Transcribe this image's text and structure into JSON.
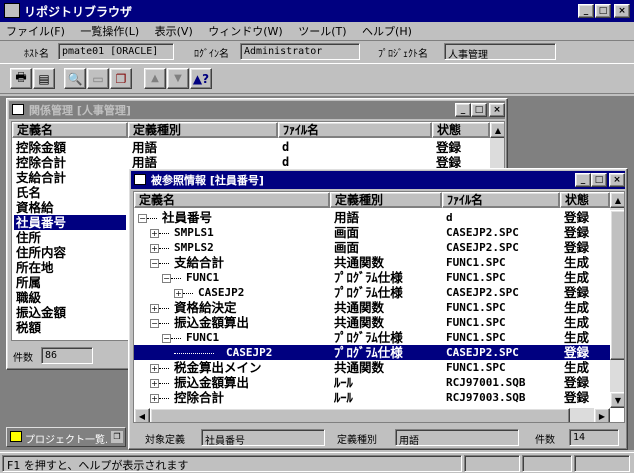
{
  "app": {
    "title": "リポジトリブラウザ"
  },
  "menu": [
    "ファイル(F)",
    "一覧操作(L)",
    "表示(V)",
    "ウィンドウ(W)",
    "ツール(T)",
    "ヘルプ(H)"
  ],
  "info": {
    "host_label": "ﾎｽﾄ名",
    "host_value": "pmate01 [ORACLE]",
    "login_label": "ﾛｸﾞｲﾝ名",
    "login_value": "Administrator",
    "project_label": "ﾌﾟﾛｼﾞｪｸﾄ名",
    "project_value": "人事管理"
  },
  "toolbar": {
    "icons": [
      "print-icon",
      "print-preview-icon",
      "search-icon",
      "copy-icon",
      "window-icon",
      "up-arrow-icon",
      "down-arrow-icon",
      "help-icon"
    ]
  },
  "relation_window": {
    "title": "関係管理 [人事管理]",
    "columns": [
      "定義名",
      "定義種別",
      "ﾌｧｲﾙ名",
      "状態"
    ],
    "rows": [
      {
        "name": "控除金額",
        "type": "用語",
        "file": "d",
        "status": "登録"
      },
      {
        "name": "控除合計",
        "type": "用語",
        "file": "d",
        "status": "登録"
      },
      {
        "name": "支給合計",
        "type": "",
        "file": "",
        "status": ""
      },
      {
        "name": "氏名",
        "type": "",
        "file": "",
        "status": ""
      },
      {
        "name": "資格給",
        "type": "",
        "file": "",
        "status": ""
      },
      {
        "name": "社員番号",
        "type": "",
        "file": "",
        "status": ""
      },
      {
        "name": "住所",
        "type": "",
        "file": "",
        "status": ""
      },
      {
        "name": "住所内容",
        "type": "",
        "file": "",
        "status": ""
      },
      {
        "name": "所在地",
        "type": "",
        "file": "",
        "status": ""
      },
      {
        "name": "所属",
        "type": "",
        "file": "",
        "status": ""
      },
      {
        "name": "職級",
        "type": "",
        "file": "",
        "status": ""
      },
      {
        "name": "振込金額",
        "type": "",
        "file": "",
        "status": ""
      },
      {
        "name": "税額",
        "type": "",
        "file": "",
        "status": ""
      }
    ],
    "count_label": "件数",
    "count_value": "86"
  },
  "minimized": {
    "title": "プロジェクト一覧..."
  },
  "referenced_window": {
    "title": "被参照情報 [社員番号]",
    "columns": [
      "定義名",
      "定義種別",
      "ﾌｧｲﾙ名",
      "状態"
    ],
    "rows": [
      {
        "name": "社員番号",
        "type": "用語",
        "file": "d",
        "status": "登録"
      },
      {
        "name": "SMPLS1",
        "type": "画面",
        "file": "CASEJP2.SPC",
        "status": "登録"
      },
      {
        "name": "SMPLS2",
        "type": "画面",
        "file": "CASEJP2.SPC",
        "status": "登録"
      },
      {
        "name": "支給合計",
        "type": "共通関数",
        "file": "FUNC1.SPC",
        "status": "生成"
      },
      {
        "name": "FUNC1",
        "type": "ﾌﾟﾛｸﾞﾗﾑ仕様",
        "file": "FUNC1.SPC",
        "status": "生成"
      },
      {
        "name": "CASEJP2",
        "type": "ﾌﾟﾛｸﾞﾗﾑ仕様",
        "file": "CASEJP2.SPC",
        "status": "登録"
      },
      {
        "name": "資格給決定",
        "type": "共通関数",
        "file": "FUNC1.SPC",
        "status": "生成"
      },
      {
        "name": "振込金額算出",
        "type": "共通関数",
        "file": "FUNC1.SPC",
        "status": "生成"
      },
      {
        "name": "FUNC1",
        "type": "ﾌﾟﾛｸﾞﾗﾑ仕様",
        "file": "FUNC1.SPC",
        "status": "生成"
      },
      {
        "name": "CASEJP2",
        "type": "ﾌﾟﾛｸﾞﾗﾑ仕様",
        "file": "CASEJP2.SPC",
        "status": "登録"
      },
      {
        "name": "税金算出メイン",
        "type": "共通関数",
        "file": "FUNC1.SPC",
        "status": "生成"
      },
      {
        "name": "振込金額算出",
        "type": "ﾙｰﾙ",
        "file": "RCJ97001.SQB",
        "status": "登録"
      },
      {
        "name": "控除合計",
        "type": "ﾙｰﾙ",
        "file": "RCJ97003.SQB",
        "status": "登録"
      }
    ],
    "target_label": "対象定義",
    "target_value": "社員番号",
    "kind_label": "定義種別",
    "kind_value": "用語",
    "count_label": "件数",
    "count_value": "14"
  },
  "status_bar": {
    "text": "F1 を押すと、ヘルプが表示されます"
  }
}
